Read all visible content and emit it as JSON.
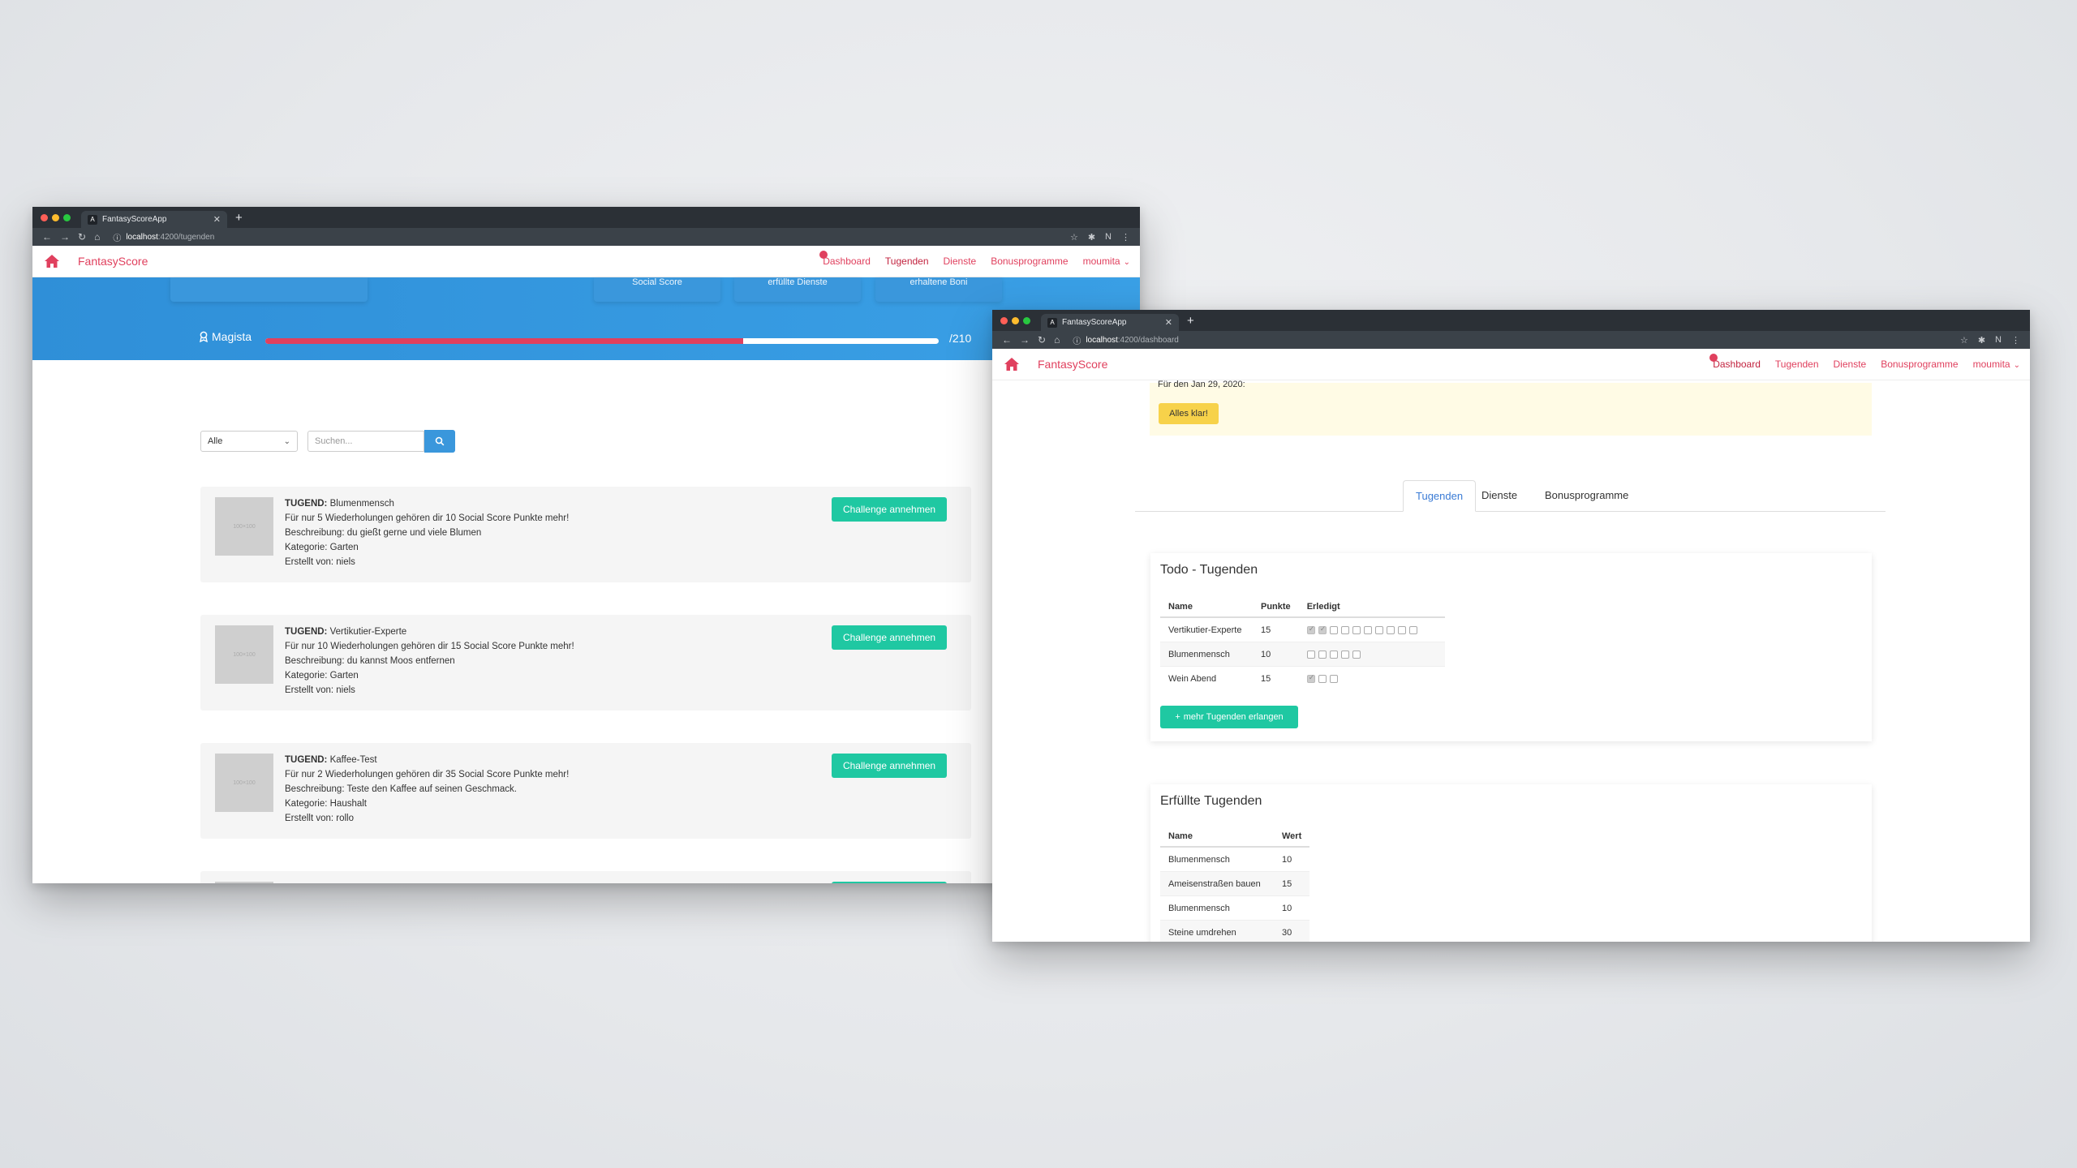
{
  "windowA": {
    "tab_title": "FantasyScoreApp",
    "url_host": "localhost",
    "url_path": ":4200/tugenden",
    "profile": "N",
    "brand": "FantasyScore",
    "nav": {
      "dashboard": "Dashboard",
      "tugenden": "Tugenden",
      "dienste": "Dienste",
      "bonus": "Bonusprogramme",
      "user": "moumita"
    },
    "hero": {
      "card_social": "Social Score",
      "card_dienste": "erfüllte Dienste",
      "card_boni": "erhaltene Boni",
      "level": "Magista",
      "progress_fraction": 0.71,
      "max": "/210"
    },
    "filter": {
      "selected": "Alle",
      "search_placeholder": "Suchen..."
    },
    "items": [
      {
        "label": "TUGEND:",
        "name": "Blumenmensch",
        "line1": "Für nur 5 Wiederholungen gehören dir 10 Social Score Punkte mehr!",
        "line2": "Beschreibung: du gießt gerne und viele Blumen",
        "line3": "Kategorie: Garten",
        "line4": "Erstellt von: niels",
        "button": "Challenge annehmen"
      },
      {
        "label": "TUGEND:",
        "name": "Vertikutier-Experte",
        "line1": "Für nur 10 Wiederholungen gehören dir 15 Social Score Punkte mehr!",
        "line2": "Beschreibung: du kannst Moos entfernen",
        "line3": "Kategorie: Garten",
        "line4": "Erstellt von: niels",
        "button": "Challenge annehmen"
      },
      {
        "label": "TUGEND:",
        "name": "Kaffee-Test",
        "line1": "Für nur 2 Wiederholungen gehören dir 35 Social Score Punkte mehr!",
        "line2": "Beschreibung: Teste den Kaffee auf seinen Geschmack.",
        "line3": "Kategorie: Haushalt",
        "line4": "Erstellt von: rollo",
        "button": "Challenge annehmen"
      }
    ]
  },
  "windowB": {
    "tab_title": "FantasyScoreApp",
    "url_host": "localhost",
    "url_path": ":4200/dashboard",
    "profile": "N",
    "brand": "FantasyScore",
    "nav": {
      "dashboard": "Dashboard",
      "tugenden": "Tugenden",
      "dienste": "Dienste",
      "bonus": "Bonusprogramme",
      "user": "moumita"
    },
    "alert": {
      "date_text": "Für den Jan 29, 2020:",
      "button": "Alles klar!"
    },
    "tabs": [
      "Tugenden",
      "Dienste",
      "Bonusprogramme"
    ],
    "todo": {
      "title": "Todo - Tugenden",
      "headers": [
        "Name",
        "Punkte",
        "Erledigt"
      ],
      "rows": [
        {
          "name": "Vertikutier-Experte",
          "points": "15",
          "done": 2,
          "total": 10
        },
        {
          "name": "Blumenmensch",
          "points": "10",
          "done": 0,
          "total": 5
        },
        {
          "name": "Wein Abend",
          "points": "15",
          "done": 1,
          "total": 3
        }
      ],
      "button": "mehr Tugenden erlangen"
    },
    "fulfilled": {
      "title": "Erfüllte Tugenden",
      "headers": [
        "Name",
        "Wert"
      ],
      "rows": [
        {
          "name": "Blumenmensch",
          "value": "10"
        },
        {
          "name": "Ameisenstraßen bauen",
          "value": "15"
        },
        {
          "name": "Blumenmensch",
          "value": "10"
        },
        {
          "name": "Steine umdrehen",
          "value": "30"
        }
      ]
    }
  }
}
